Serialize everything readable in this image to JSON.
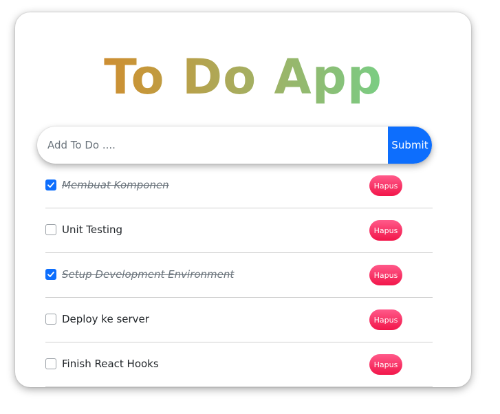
{
  "app": {
    "title": "To Do App"
  },
  "form": {
    "placeholder": "Add To Do ....",
    "value": "",
    "submit_label": "Submit"
  },
  "todos": [
    {
      "label": "Membuat Komponen",
      "done": true,
      "delete_label": "Hapus"
    },
    {
      "label": "Unit Testing",
      "done": false,
      "delete_label": "Hapus"
    },
    {
      "label": "Setup Development Environment",
      "done": true,
      "delete_label": "Hapus"
    },
    {
      "label": "Deploy ke server",
      "done": false,
      "delete_label": "Hapus"
    },
    {
      "label": "Finish React Hooks",
      "done": false,
      "delete_label": "Hapus"
    }
  ],
  "colors": {
    "accent": "#0d6efd",
    "delete_top": "#ff5a8a",
    "delete_bottom": "#f2164a",
    "title_gradient": [
      "#dc7a22",
      "#c6973a",
      "#a7ad5f",
      "#86c27a",
      "#5ee99a"
    ]
  },
  "icons": {
    "checkbox_checked": "check-icon"
  }
}
